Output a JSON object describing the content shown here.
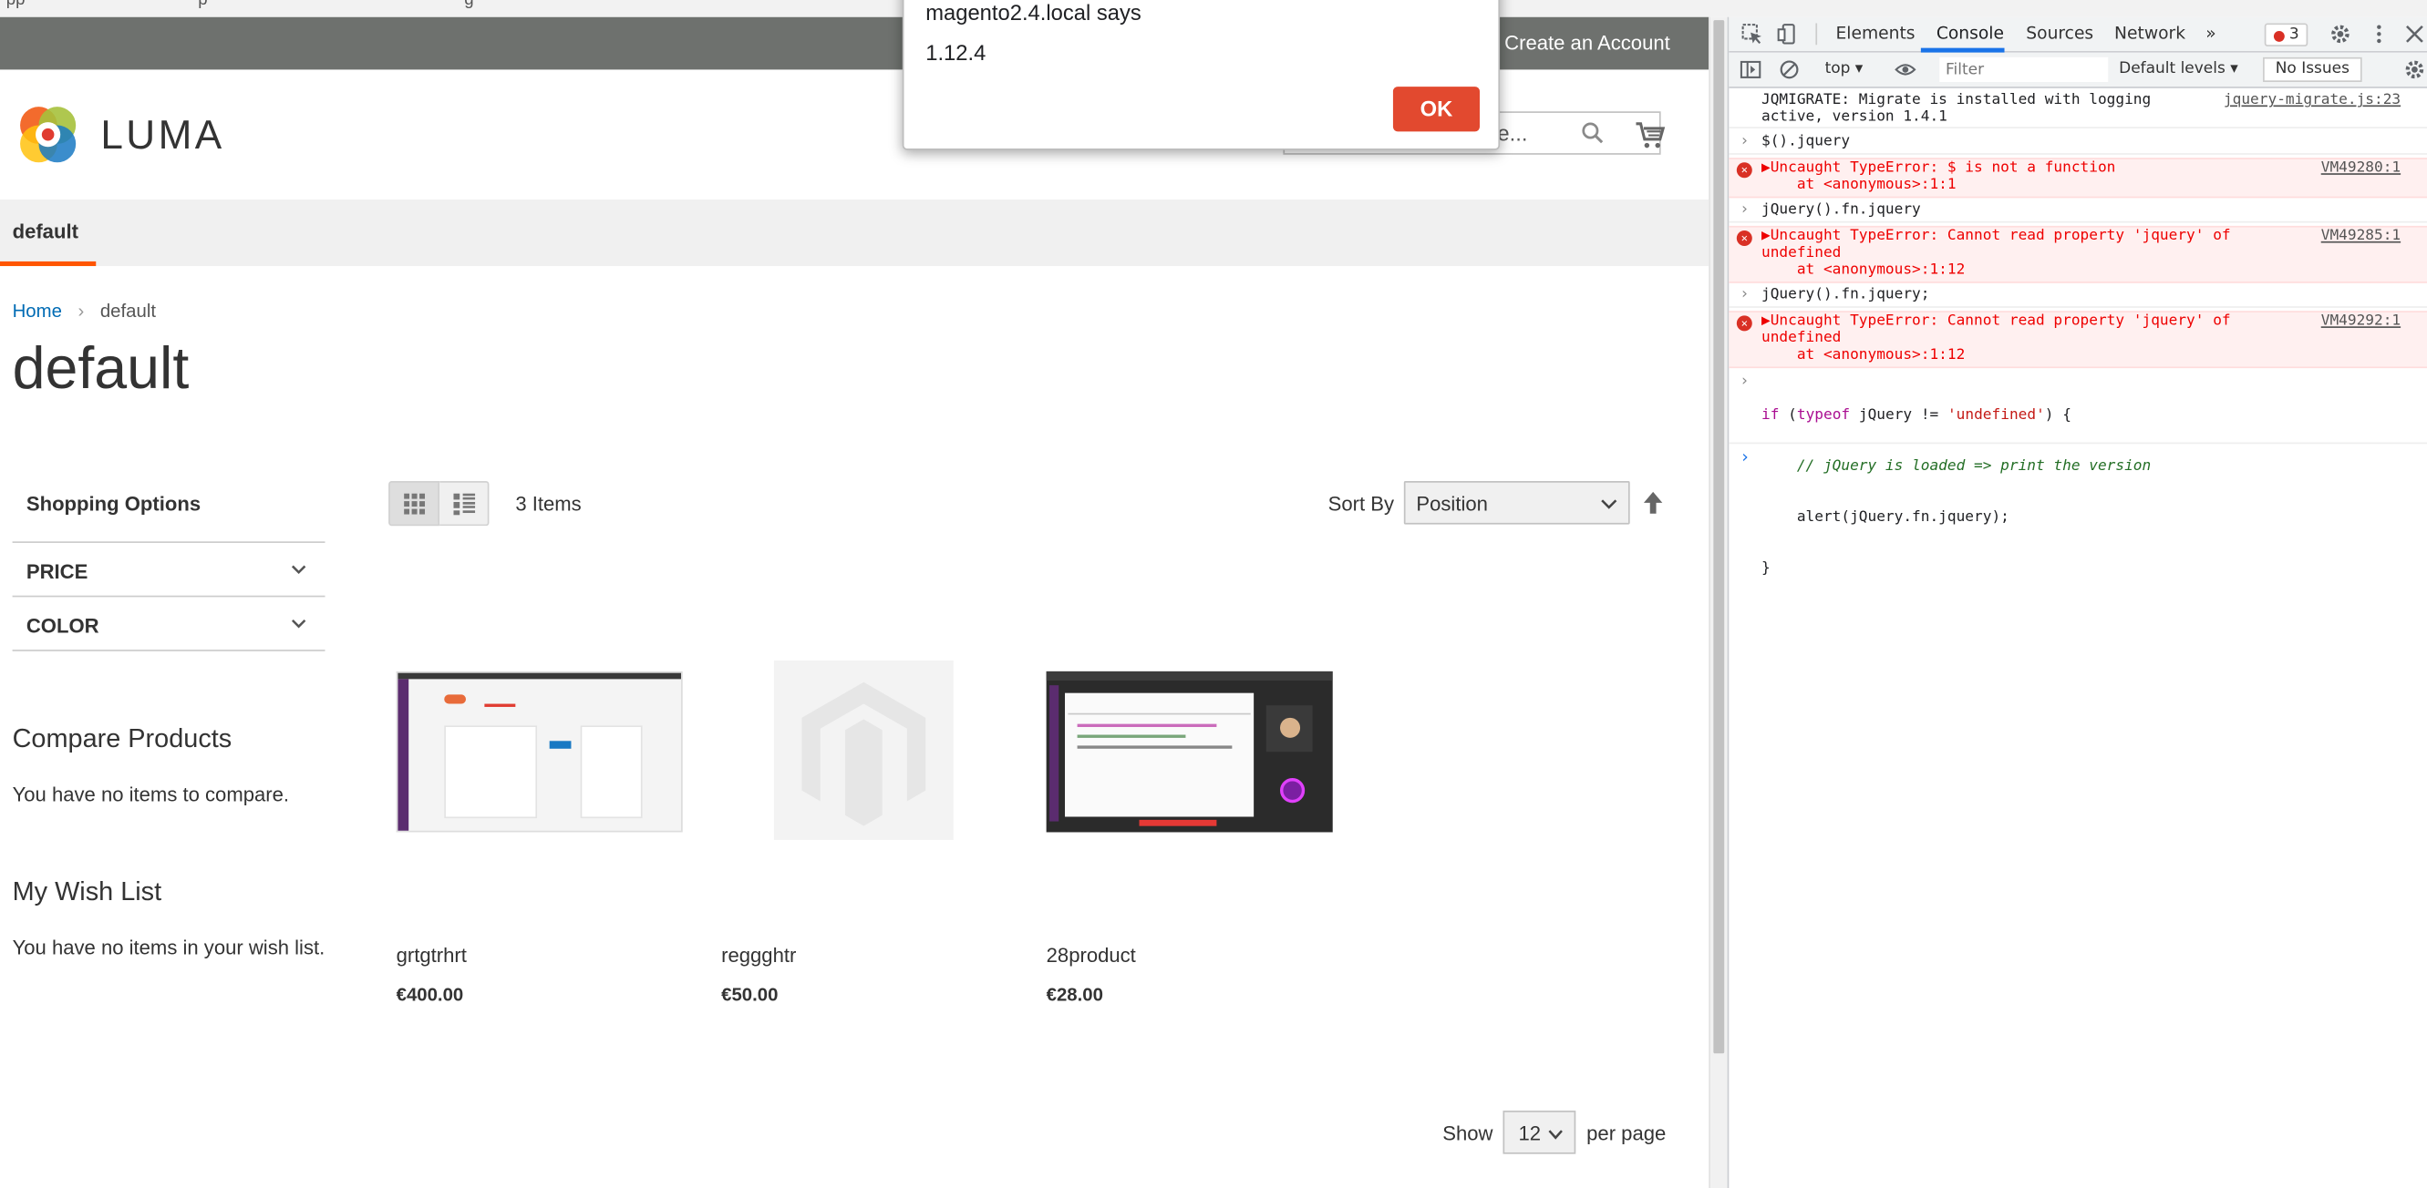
{
  "browser": {
    "bookmarks": [
      "pp",
      "p",
      "g"
    ]
  },
  "header": {
    "create_account": "Create an Account",
    "logo_text": "LUMA",
    "search_placeholder": "ere..."
  },
  "nav": {
    "items": [
      "default"
    ]
  },
  "breadcrumb": {
    "home": "Home",
    "separator": "›",
    "current": "default"
  },
  "page_title": "default",
  "sidebar": {
    "shopping_options": "Shopping Options",
    "filters": [
      "PRICE",
      "COLOR"
    ],
    "compare_title": "Compare Products",
    "compare_text": "You have no items to compare.",
    "wishlist_title": "My Wish List",
    "wishlist_text": "You have no items in your wish list."
  },
  "toolbar": {
    "items_count": "3 Items",
    "sort_by_label": "Sort By",
    "sort_value": "Position",
    "show_label": "Show",
    "limiter_value": "12",
    "per_page_label": "per page"
  },
  "products": [
    {
      "name": "grtgtrhrt",
      "price": "€400.00"
    },
    {
      "name": "reggghtr",
      "price": "€50.00"
    },
    {
      "name": "28product",
      "price": "€28.00"
    }
  ],
  "alert": {
    "title": "magento2.4.local says",
    "message": "1.12.4",
    "ok_label": "OK"
  },
  "devtools": {
    "tabs": [
      "Elements",
      "Console",
      "Sources",
      "Network"
    ],
    "more_tabs": "»",
    "active_tab": "Console",
    "error_count": "3",
    "context": "top ▾",
    "filter_placeholder": "Filter",
    "levels": "Default levels ▾",
    "issues": "No Issues",
    "console": [
      {
        "type": "log",
        "text": "JQMIGRATE: Migrate is installed with logging\nactive, version 1.4.1",
        "link": "jquery-migrate.js:23"
      },
      {
        "type": "input",
        "text": "$().jquery"
      },
      {
        "type": "error",
        "text": "▶Uncaught TypeError: $ is not a function\n    at <anonymous>:1:1",
        "link": "VM49280:1"
      },
      {
        "type": "input",
        "text": "jQuery().fn.jquery"
      },
      {
        "type": "error",
        "text": "▶Uncaught TypeError: Cannot read property 'jquery' of\nundefined\n    at <anonymous>:1:12",
        "link": "VM49285:1"
      },
      {
        "type": "input",
        "text": "jQuery().fn.jquery;"
      },
      {
        "type": "error",
        "text": "▶Uncaught TypeError: Cannot read property 'jquery' of\nundefined\n    at <anonymous>:1:12",
        "link": "VM49292:1"
      }
    ],
    "code_line1_kw": "if",
    "code_line1_a": " (",
    "code_line1_typeof": "typeof",
    "code_line1_b": " jQuery != ",
    "code_line1_str": "'undefined'",
    "code_line1_c": ") {",
    "code_line2": "    // jQuery is loaded => print the version",
    "code_line3": "    alert(jQuery.fn.jquery);",
    "code_line4": "}",
    "input_prompt": "›",
    "caret": "›"
  },
  "colors": {
    "accent_orange": "#ff5501",
    "link_blue": "#006bb4",
    "alert_ok": "#e2492f",
    "devtools_blue": "#1a73e8",
    "error_red": "#d93025"
  }
}
